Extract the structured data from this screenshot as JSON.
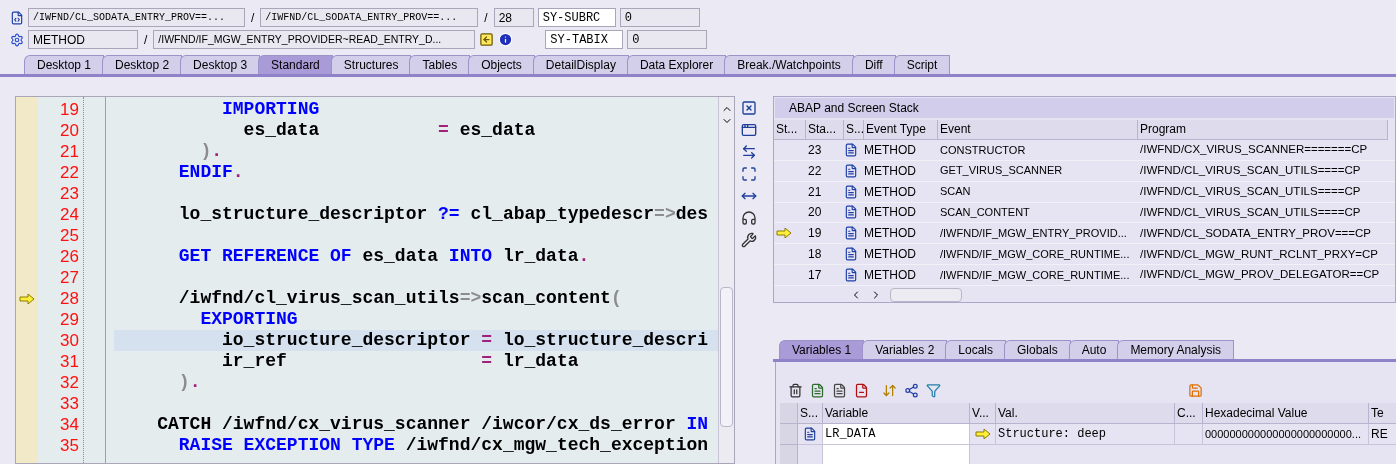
{
  "header": {
    "row_1": {
      "program": "/IWFND/CL_SODATA_ENTRY_PROV==...",
      "include": "/IWFND/CL_SODATA_ENTRY_PROV==...",
      "line": "28",
      "sysvar": "SY-SUBRC",
      "sysvalue": "0"
    },
    "row_2": {
      "event_type": "METHOD",
      "event": "/IWFND/IF_MGW_ENTRY_PROVIDER~READ_ENTRY_D...",
      "sysvar": "SY-TABIX",
      "sysvalue": "0"
    },
    "separator": "/"
  },
  "tabs": [
    {
      "label": "Desktop 1",
      "selected": false
    },
    {
      "label": "Desktop 2",
      "selected": false
    },
    {
      "label": "Desktop 3",
      "selected": false
    },
    {
      "label": "Standard",
      "selected": true
    },
    {
      "label": "Structures",
      "selected": false
    },
    {
      "label": "Tables",
      "selected": false
    },
    {
      "label": "Objects",
      "selected": false
    },
    {
      "label": "DetailDisplay",
      "selected": false
    },
    {
      "label": "Data Explorer",
      "selected": false
    },
    {
      "label": "Break./Watchpoints",
      "selected": false
    },
    {
      "label": "Diff",
      "selected": false
    },
    {
      "label": "Script",
      "selected": false
    }
  ],
  "editor": {
    "lines": [
      {
        "number": "19",
        "current": false,
        "highlighted": false,
        "tokens": [
          {
            "kind": "kw",
            "text": "          IMPORTING"
          }
        ]
      },
      {
        "number": "20",
        "current": false,
        "highlighted": false,
        "tokens": [
          {
            "kind": "plain",
            "text": "            es_data           "
          },
          {
            "kind": "op",
            "text": "="
          },
          {
            "kind": "plain",
            "text": " es_data"
          }
        ]
      },
      {
        "number": "21",
        "current": false,
        "highlighted": false,
        "tokens": [
          {
            "kind": "dim",
            "text": "        )"
          },
          {
            "kind": "op",
            "text": "."
          }
        ]
      },
      {
        "number": "22",
        "current": false,
        "highlighted": false,
        "tokens": [
          {
            "kind": "kw",
            "text": "      ENDIF"
          },
          {
            "kind": "op",
            "text": "."
          }
        ]
      },
      {
        "number": "23",
        "current": false,
        "highlighted": false
      },
      {
        "number": "24",
        "current": false,
        "highlighted": false,
        "tokens": [
          {
            "kind": "plain",
            "text": "      lo_structure_descriptor "
          },
          {
            "kind": "kw",
            "text": "?="
          },
          {
            "kind": "plain",
            "text": " cl_abap_typedescr"
          },
          {
            "kind": "dim",
            "text": "=>"
          },
          {
            "kind": "plain",
            "text": "des"
          }
        ]
      },
      {
        "number": "25",
        "current": false,
        "highlighted": false
      },
      {
        "number": "26",
        "current": false,
        "highlighted": false,
        "tokens": [
          {
            "kind": "kw",
            "text": "      GET REFERENCE OF"
          },
          {
            "kind": "plain",
            "text": " es_data "
          },
          {
            "kind": "kw",
            "text": "INTO"
          },
          {
            "kind": "plain",
            "text": " lr_data"
          },
          {
            "kind": "op",
            "text": "."
          }
        ]
      },
      {
        "number": "27",
        "current": false,
        "highlighted": false
      },
      {
        "number": "28",
        "current": true,
        "highlighted": false,
        "tokens": [
          {
            "kind": "plain",
            "text": "      /iwfnd/cl_virus_scan_utils"
          },
          {
            "kind": "dim",
            "text": "=>"
          },
          {
            "kind": "plain",
            "text": "scan_content"
          },
          {
            "kind": "dim",
            "text": "("
          }
        ]
      },
      {
        "number": "29",
        "current": false,
        "highlighted": false,
        "tokens": [
          {
            "kind": "kw",
            "text": "        EXPORTING"
          }
        ]
      },
      {
        "number": "30",
        "current": false,
        "highlighted": true,
        "tokens": [
          {
            "kind": "plain",
            "text": "          io_structure_descriptor "
          },
          {
            "kind": "op",
            "text": "="
          },
          {
            "kind": "plain",
            "text": " lo_structure_descri"
          }
        ]
      },
      {
        "number": "31",
        "current": false,
        "highlighted": false,
        "tokens": [
          {
            "kind": "plain",
            "text": "          ir_ref                  "
          },
          {
            "kind": "op",
            "text": "="
          },
          {
            "kind": "plain",
            "text": " lr_data"
          }
        ]
      },
      {
        "number": "32",
        "current": false,
        "highlighted": false,
        "tokens": [
          {
            "kind": "dim",
            "text": "      )"
          },
          {
            "kind": "op",
            "text": "."
          }
        ]
      },
      {
        "number": "33",
        "current": false,
        "highlighted": false
      },
      {
        "number": "34",
        "current": false,
        "highlighted": false,
        "tokens": [
          {
            "kind": "plain",
            "text": "    CATCH /iwfnd/cx_virus_scanner /iwcor/cx_ds_error "
          },
          {
            "kind": "kw",
            "text": "IN"
          }
        ]
      },
      {
        "number": "35",
        "current": false,
        "highlighted": false,
        "tokens": [
          {
            "kind": "kw",
            "text": "      RAISE EXCEPTION TYPE"
          },
          {
            "kind": "plain",
            "text": " /iwfnd/cx_mgw_tech_exception"
          }
        ]
      }
    ]
  },
  "stack": {
    "title": "ABAP and Screen Stack",
    "columns": [
      "St...",
      "Sta...",
      "S...",
      "Event Type",
      "Event",
      "Program"
    ],
    "rows": [
      {
        "current": false,
        "level": "23",
        "event_type": "METHOD",
        "event": "CONSTRUCTOR",
        "program": "/IWFND/CX_VIRUS_SCANNER=======CP"
      },
      {
        "current": false,
        "level": "22",
        "event_type": "METHOD",
        "event": "GET_VIRUS_SCANNER",
        "program": "/IWFND/CL_VIRUS_SCAN_UTILS====CP"
      },
      {
        "current": false,
        "level": "21",
        "event_type": "METHOD",
        "event": "SCAN",
        "program": "/IWFND/CL_VIRUS_SCAN_UTILS====CP"
      },
      {
        "current": false,
        "level": "20",
        "event_type": "METHOD",
        "event": "SCAN_CONTENT",
        "program": "/IWFND/CL_VIRUS_SCAN_UTILS====CP"
      },
      {
        "current": true,
        "level": "19",
        "event_type": "METHOD",
        "event": "/IWFND/IF_MGW_ENTRY_PROVID...",
        "program": "/IWFND/CL_SODATA_ENTRY_PROV===CP"
      },
      {
        "current": false,
        "level": "18",
        "event_type": "METHOD",
        "event": "/IWFND/IF_MGW_CORE_RUNTIME...",
        "program": "/IWFND/CL_MGW_RUNT_RCLNT_PRXY=CP"
      },
      {
        "current": false,
        "level": "17",
        "event_type": "METHOD",
        "event": "/IWFND/IF_MGW_CORE_RUNTIME...",
        "program": "/IWFND/CL_MGW_PROV_DELEGATOR==CP"
      }
    ]
  },
  "variables": {
    "tabs": [
      {
        "label": "Variables 1",
        "selected": true
      },
      {
        "label": "Variables 2",
        "selected": false
      },
      {
        "label": "Locals",
        "selected": false
      },
      {
        "label": "Globals",
        "selected": false
      },
      {
        "label": "Auto",
        "selected": false
      },
      {
        "label": "Memory Analysis",
        "selected": false
      }
    ],
    "columns": [
      "S...",
      "Variable",
      "V...",
      "Val.",
      "C...",
      "Hexadecimal Value",
      "Te"
    ],
    "rows": [
      {
        "variable": "LR_DATA",
        "value": "Structure: deep",
        "hex": "000000000000000000000000...",
        "column_7": "RE"
      }
    ]
  }
}
